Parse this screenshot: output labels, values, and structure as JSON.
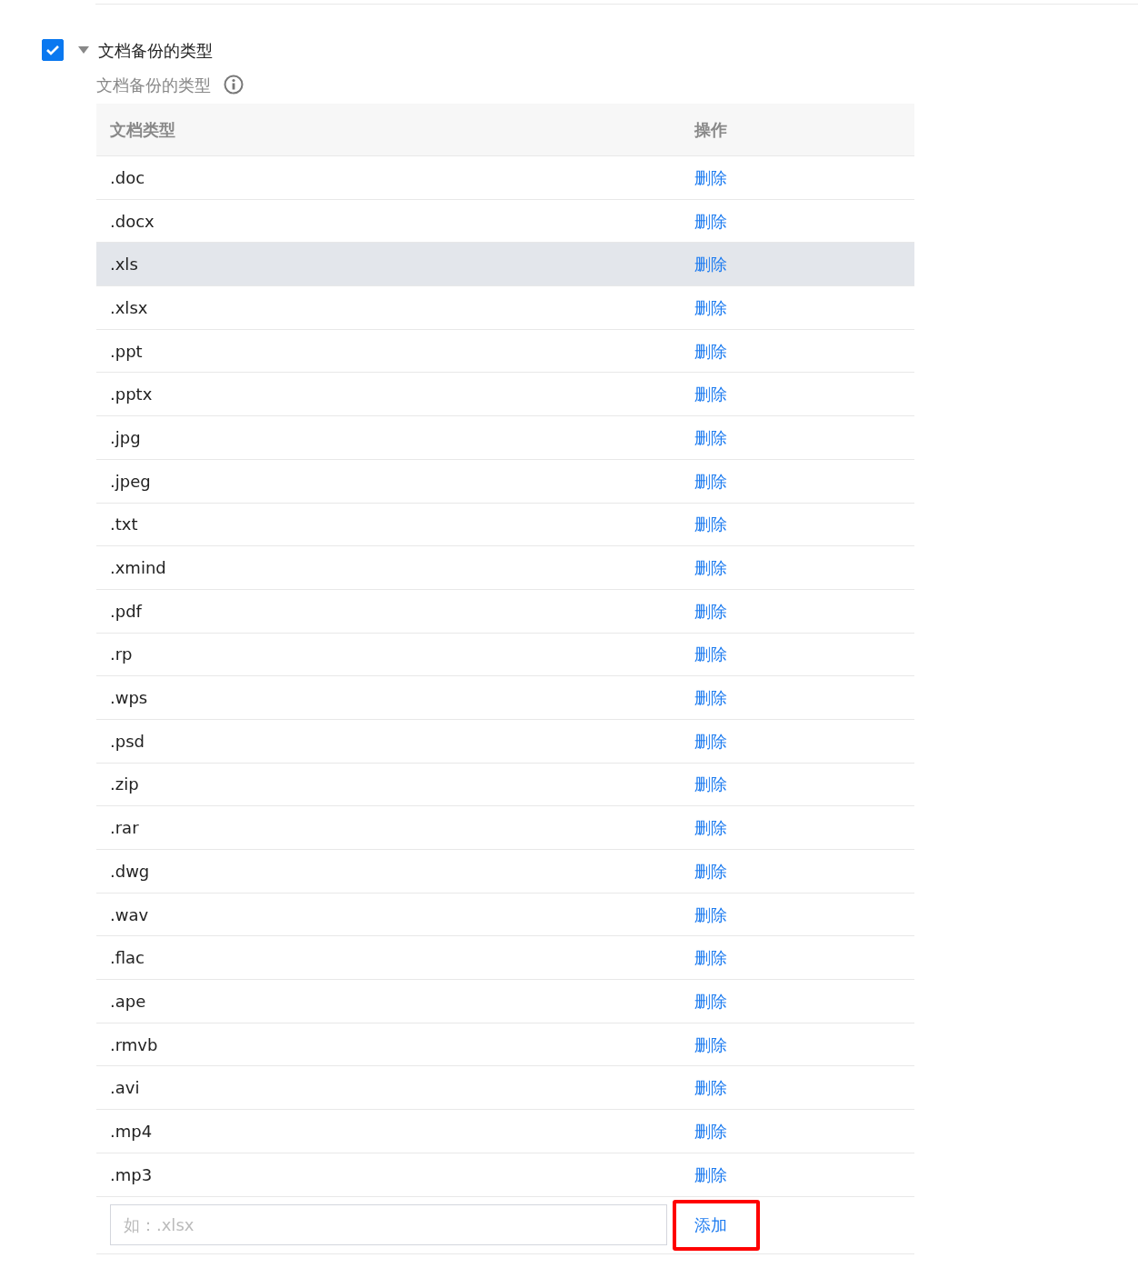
{
  "section": {
    "checked": true,
    "expanded": true,
    "title": "文档备份的类型"
  },
  "field_label": "文档备份的类型",
  "table": {
    "columns": [
      "文档类型",
      "操作"
    ],
    "rows": [
      {
        "type": ".doc",
        "action": "删除",
        "hovered": false
      },
      {
        "type": ".docx",
        "action": "删除",
        "hovered": false
      },
      {
        "type": ".xls",
        "action": "删除",
        "hovered": true
      },
      {
        "type": ".xlsx",
        "action": "删除",
        "hovered": false
      },
      {
        "type": ".ppt",
        "action": "删除",
        "hovered": false
      },
      {
        "type": ".pptx",
        "action": "删除",
        "hovered": false
      },
      {
        "type": ".jpg",
        "action": "删除",
        "hovered": false
      },
      {
        "type": ".jpeg",
        "action": "删除",
        "hovered": false
      },
      {
        "type": ".txt",
        "action": "删除",
        "hovered": false
      },
      {
        "type": ".xmind",
        "action": "删除",
        "hovered": false
      },
      {
        "type": ".pdf",
        "action": "删除",
        "hovered": false
      },
      {
        "type": ".rp",
        "action": "删除",
        "hovered": false
      },
      {
        "type": ".wps",
        "action": "删除",
        "hovered": false
      },
      {
        "type": ".psd",
        "action": "删除",
        "hovered": false
      },
      {
        "type": ".zip",
        "action": "删除",
        "hovered": false
      },
      {
        "type": ".rar",
        "action": "删除",
        "hovered": false
      },
      {
        "type": ".dwg",
        "action": "删除",
        "hovered": false
      },
      {
        "type": ".wav",
        "action": "删除",
        "hovered": false
      },
      {
        "type": ".flac",
        "action": "删除",
        "hovered": false
      },
      {
        "type": ".ape",
        "action": "删除",
        "hovered": false
      },
      {
        "type": ".rmvb",
        "action": "删除",
        "hovered": false
      },
      {
        "type": ".avi",
        "action": "删除",
        "hovered": false
      },
      {
        "type": ".mp4",
        "action": "删除",
        "hovered": false
      },
      {
        "type": ".mp3",
        "action": "删除",
        "hovered": false
      }
    ]
  },
  "new_type": {
    "placeholder": "如：.xlsx"
  },
  "add_button": {
    "label": "添加",
    "highlighted": true
  }
}
